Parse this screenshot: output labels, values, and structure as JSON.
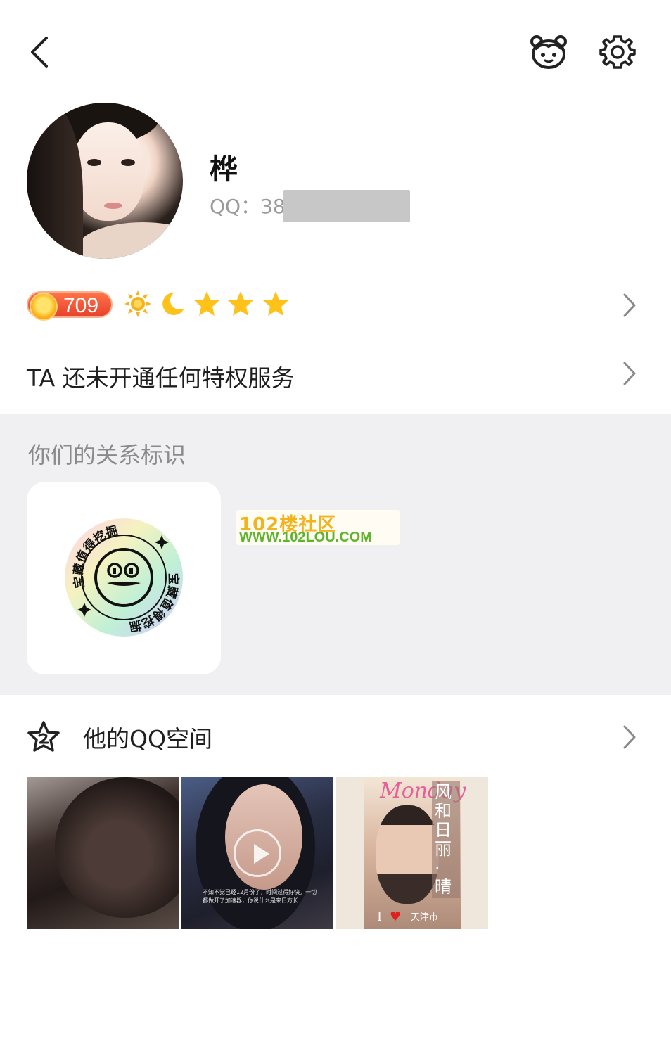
{
  "header": {
    "back_icon": "chevron-left-icon",
    "bear_icon": "bear-face-icon",
    "settings_icon": "gear-icon"
  },
  "profile": {
    "nickname": "桦",
    "qq_label": "QQ：38",
    "qq_masked": true
  },
  "level": {
    "value": "709",
    "icons": [
      "sun-icon",
      "moon-icon",
      "star-icon",
      "star-icon",
      "star-icon"
    ]
  },
  "privilege": {
    "text": "TA 还未开通任何特权服务"
  },
  "relation": {
    "title": "你们的关系标识",
    "badge_text": "宝藏值得挖掘"
  },
  "watermark": {
    "title": "102楼社区",
    "url": "WWW.102LOU.COM"
  },
  "qzone": {
    "label": "他的QQ空间",
    "photos": [
      {
        "kind": "image"
      },
      {
        "kind": "video",
        "caption": "不知不觉已经12月份了，时间过得好快。一切都做开了加速器，你说什么是来日方长…"
      },
      {
        "kind": "image",
        "overlay_title": "Monday",
        "vertical_text": "风和日丽·晴",
        "city": "天津市",
        "love_prefix": "I"
      }
    ]
  },
  "colors": {
    "accent_orange": "#e7412c",
    "section_bg": "#f0f0f2",
    "muted_text": "#9a9a9a",
    "star_yellow": "#ffc21a"
  }
}
